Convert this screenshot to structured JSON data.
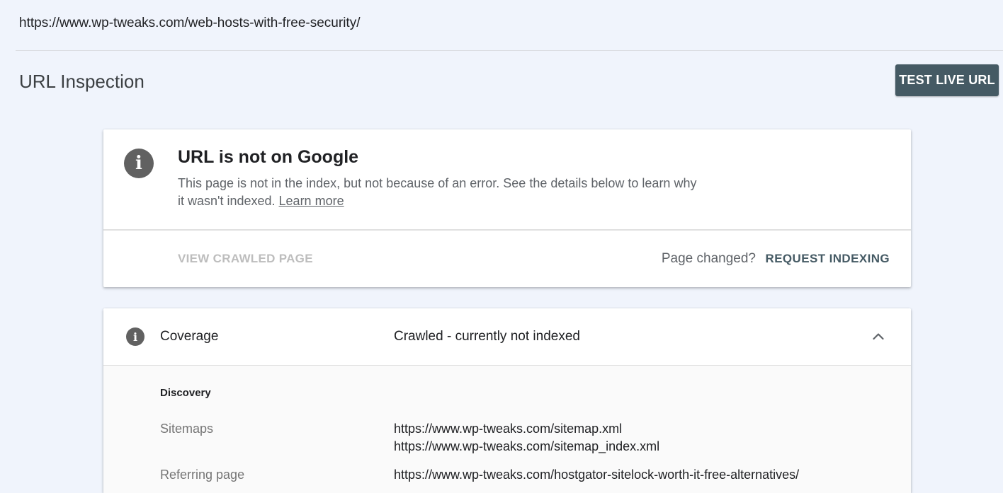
{
  "header": {
    "inspected_url": "https://www.wp-tweaks.com/web-hosts-with-free-security/"
  },
  "page": {
    "title": "URL Inspection",
    "test_live_url_label": "TEST LIVE URL"
  },
  "status_card": {
    "icon": "info-icon",
    "heading": "URL is not on Google",
    "description": "This page is not in the index, but not because of an error. See the details below to learn why it wasn't indexed.",
    "learn_more_label": "Learn more",
    "view_crawled_label": "VIEW CRAWLED PAGE",
    "page_changed_label": "Page changed?",
    "request_indexing_label": "REQUEST INDEXING"
  },
  "coverage": {
    "icon": "info-icon",
    "label": "Coverage",
    "value": "Crawled - currently not indexed",
    "expanded": true,
    "discovery": {
      "heading": "Discovery",
      "sitemaps_label": "Sitemaps",
      "sitemaps": [
        "https://www.wp-tweaks.com/sitemap.xml",
        "https://www.wp-tweaks.com/sitemap_index.xml"
      ],
      "referring_page_label": "Referring page",
      "referring_page": "https://www.wp-tweaks.com/hostgator-sitelock-worth-it-free-alternatives/"
    }
  },
  "colors": {
    "page_background": "#f0f4fc",
    "primary_button": "#455a64",
    "icon_gray": "#616161",
    "disabled_text": "#bdbdbd"
  }
}
